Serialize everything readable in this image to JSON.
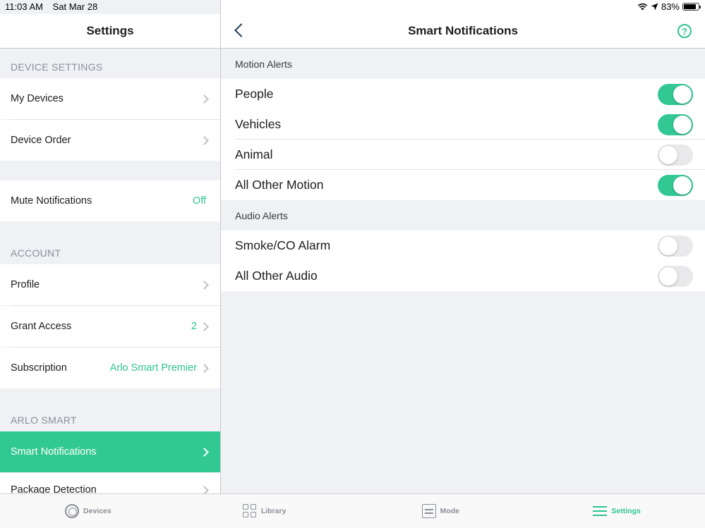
{
  "status_bar": {
    "time": "11:03 AM",
    "date": "Sat Mar 28",
    "battery": "83%",
    "battery_level": 0.83
  },
  "left": {
    "title": "Settings",
    "sections": {
      "device_settings": "DEVICE SETTINGS",
      "account": "ACCOUNT",
      "arlo_smart": "ARLO SMART"
    },
    "rows": {
      "my_devices": "My Devices",
      "device_order": "Device Order",
      "mute_notifications": "Mute Notifications",
      "mute_value": "Off",
      "profile": "Profile",
      "grant_access": "Grant Access",
      "grant_access_value": "2",
      "subscription": "Subscription",
      "subscription_value": "Arlo Smart Premier",
      "smart_notifications": "Smart Notifications",
      "package_detection": "Package Detection"
    }
  },
  "right": {
    "title": "Smart Notifications",
    "help_symbol": "?",
    "motion_alerts_label": "Motion Alerts",
    "audio_alerts_label": "Audio Alerts",
    "motion_alerts": [
      {
        "label": "People",
        "on": true
      },
      {
        "label": "Vehicles",
        "on": true
      },
      {
        "label": "Animal",
        "on": false
      },
      {
        "label": "All Other Motion",
        "on": true
      }
    ],
    "audio_alerts": [
      {
        "label": "Smoke/CO Alarm",
        "on": false
      },
      {
        "label": "All Other Audio",
        "on": false
      }
    ]
  },
  "tabs": [
    {
      "label": "Devices",
      "icon": "devices-icon"
    },
    {
      "label": "Library",
      "icon": "library-icon"
    },
    {
      "label": "Mode",
      "icon": "mode-icon"
    },
    {
      "label": "Settings",
      "icon": "settings-icon",
      "active": true
    }
  ],
  "colors": {
    "accent": "#32c894",
    "background": "#eff1f4"
  }
}
